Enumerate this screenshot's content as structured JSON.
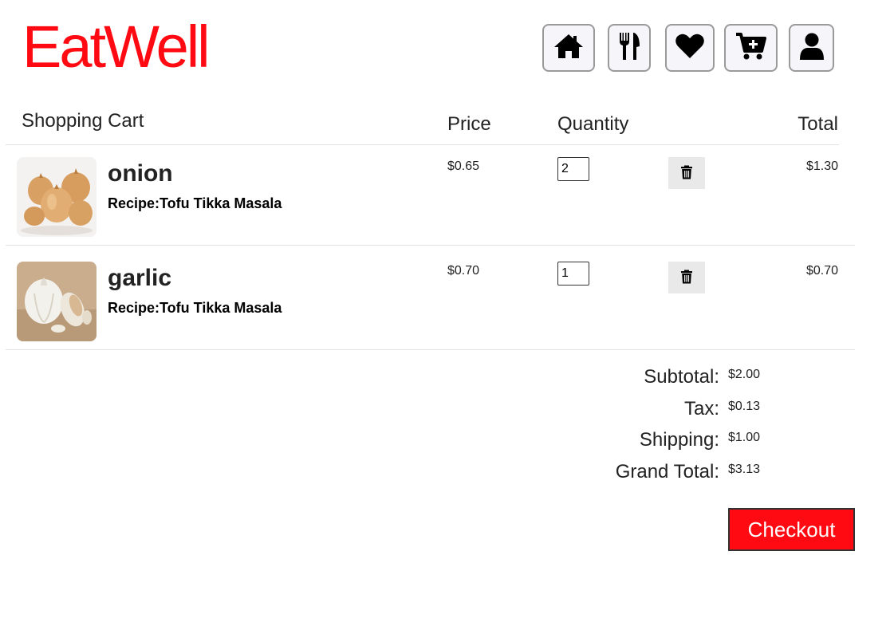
{
  "brand": {
    "name": "EatWell",
    "color": "#ff0a12"
  },
  "nav": [
    {
      "icon": "home-icon"
    },
    {
      "icon": "utensils-icon"
    },
    {
      "icon": "heart-icon"
    },
    {
      "icon": "cart-plus-icon"
    },
    {
      "icon": "user-icon"
    }
  ],
  "cart": {
    "title": "Shopping Cart",
    "columns": {
      "price": "Price",
      "quantity": "Quantity",
      "total": "Total"
    },
    "items": [
      {
        "name": "onion",
        "recipe": "Recipe:Tofu Tikka Masala",
        "price": "$0.65",
        "quantity": "2",
        "total": "$1.30",
        "image": "onion-photo"
      },
      {
        "name": "garlic",
        "recipe": "Recipe:Tofu Tikka Masala",
        "price": "$0.70",
        "quantity": "1",
        "total": "$0.70",
        "image": "garlic-photo"
      }
    ]
  },
  "summary": {
    "subtotal_label": "Subtotal:",
    "subtotal": "$2.00",
    "tax_label": "Tax:",
    "tax": "$0.13",
    "shipping_label": "Shipping:",
    "shipping": "$1.00",
    "grand_total_label": "Grand Total:",
    "grand_total": "$3.13"
  },
  "checkout_label": "Checkout"
}
